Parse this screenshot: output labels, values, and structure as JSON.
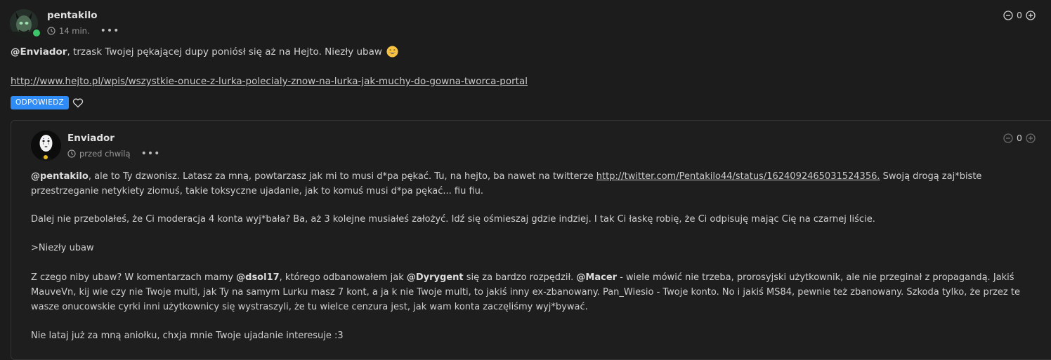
{
  "post": {
    "username": "pentakilo",
    "time": "14 min.",
    "more": "•••",
    "vote_count": "0",
    "mention": "@Enviador",
    "text": ", trzask Twojej pękającej dupy poniósł się aż na Hejto. Niezły ubaw",
    "emoji": "grinning-face",
    "link": "http://www.hejto.pl/wpis/wszystkie-onuce-z-lurka-polecialy-znow-na-lurka-jak-muchy-do-gowna-tworca-portal",
    "reply_label": "ODPOWIEDZ"
  },
  "reply": {
    "username": "Enviador",
    "time": "przed chwilą",
    "more": "•••",
    "vote_count": "0",
    "p1": {
      "mention": "@pentakilo",
      "text_a": ", ale to Ty dzwonisz. Latasz za mną, powtarzasz jak mi to musi d*pa pękać. Tu, na hejto, ba nawet na twitterze ",
      "link": "http://twitter.com/Pentakilo44/status/1624092465031524356.",
      "text_b": " Swoją drogą zaj*biste przestrzeganie netykiety ziomuś, takie toksyczne ujadanie, jak to komuś musi d*pa pękać... fiu fiu."
    },
    "p2": "Dalej nie przebolałeś, że Ci moderacja 4 konta wyj*bała? Ba, aż 3 kolejne musiałeś założyć. Idź się ośmieszaj gdzie indziej. I tak Ci łaskę robię, że Ci odpisuję mając Cię na czarnej liście.",
    "p3": ">Niezły ubaw",
    "p4": {
      "t1": "Z czego niby ubaw? W komentarzach mamy ",
      "m1": "@dsol17",
      "t2": ", którego odbanowałem jak ",
      "m2": "@Dyrygent",
      "t3": " się za bardzo rozpędził. ",
      "m3": "@Macer",
      "t4": " - wiele mówić nie trzeba, prorosyjski użytkownik, ale nie przeginał z propagandą. Jakiś MauveVn, kij wie czy nie Twoje multi, jak Ty na samym Lurku masz 7 kont, a ja k nie Twoje multi, to jakiś inny ex-zbanowany. Pan_Wiesio - Twoje konto. No i jakiś MS84, pewnie też zbanowany. Szkoda tylko, że przez te wasze onucowskie cyrki inni użytkownicy się wystraszyli, że tu wielce cenzura jest, jak wam konta zaczęliśmy wyj*bywać."
    },
    "p5": "Nie lataj już za mną aniołku, chxja mnie Twoje ujadanie interesuje :3"
  },
  "colors": {
    "background": "#1c1c1c",
    "accent": "#2f8bf5",
    "online": "#3cc46a"
  }
}
